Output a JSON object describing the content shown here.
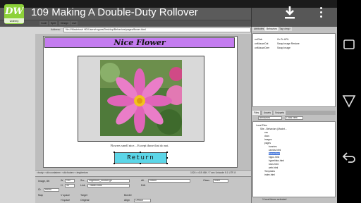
{
  "overlay": {
    "title": "109  Making A Double-Duty Rollover",
    "logo_text": "DW",
    "logo_sub": "Udemy"
  },
  "dreamweaver": {
    "app_name": "Dreamweaver",
    "address_label": "Address:",
    "address_value": "file:///Macintosh HD/Users/rogues/Desktop/Behaviors/pages/flower.html",
    "page_title": "Nice Flower",
    "caption": "Flowers smell nice... Except those that do not.",
    "return_label": "Return",
    "status_text": "<body> <div.container> <div.footer> <img#return",
    "status_right": "1024 x 415  48K / 7 sec  Unicode 5.1 UTF-8",
    "properties": {
      "label_image": "Image, 8K",
      "id_value": "return",
      "w_value": "150",
      "h_value": "34",
      "src_value": "img/return_rollover.gif",
      "link_value": "../index.html",
      "alt_value": "Return",
      "class_value": "None",
      "edit_label": "Edit",
      "map_label": "Map",
      "vspace_label": "V space",
      "hspace_label": "H space",
      "target_label": "Target",
      "border_label": "Border",
      "original_label": "Original",
      "align_label": "Align",
      "align_value": "Default"
    },
    "panels": {
      "tabs": [
        "Attributes",
        "Behaviors",
        "Tag <img>"
      ],
      "behaviors": [
        {
          "event": "onClick",
          "action": "Go To URL"
        },
        {
          "event": "onMouseOut",
          "action": "Swap Image Restore"
        },
        {
          "event": "onMouseOver",
          "action": "Swap Image"
        }
      ],
      "files_tabs": [
        "Files",
        "Assets",
        "Snippets"
      ],
      "site_select": "Behaviors",
      "view_select": "Local view",
      "files": [
        {
          "name": "Local Files",
          "indent": 0,
          "selected": false
        },
        {
          "name": "Site - Behaviors (Macint...",
          "indent": 1,
          "selected": false
        },
        {
          "name": "css",
          "indent": 2,
          "selected": false
        },
        {
          "name": "docs",
          "indent": 2,
          "selected": false
        },
        {
          "name": "images",
          "indent": 2,
          "selected": false
        },
        {
          "name": "pages",
          "indent": 2,
          "selected": false
        },
        {
          "name": "bunnies",
          "indent": 3,
          "selected": false
        },
        {
          "name": "carrots.html",
          "indent": 3,
          "selected": false
        },
        {
          "name": "flower.html",
          "indent": 3,
          "selected": true
        },
        {
          "name": "hippo.html",
          "indent": 3,
          "selected": false
        },
        {
          "name": "hyperlinks.html",
          "indent": 3,
          "selected": false
        },
        {
          "name": "lotus.html",
          "indent": 3,
          "selected": false
        },
        {
          "name": "web.html",
          "indent": 3,
          "selected": false
        },
        {
          "name": "Templates",
          "indent": 2,
          "selected": false
        },
        {
          "name": "index.html",
          "indent": 2,
          "selected": false
        }
      ],
      "files_status": "1 local items selected"
    }
  },
  "colors": {
    "title_bg": "#c47cf0",
    "return_bg": "#5cd6e8",
    "logo_bg": "#8dd13a"
  }
}
